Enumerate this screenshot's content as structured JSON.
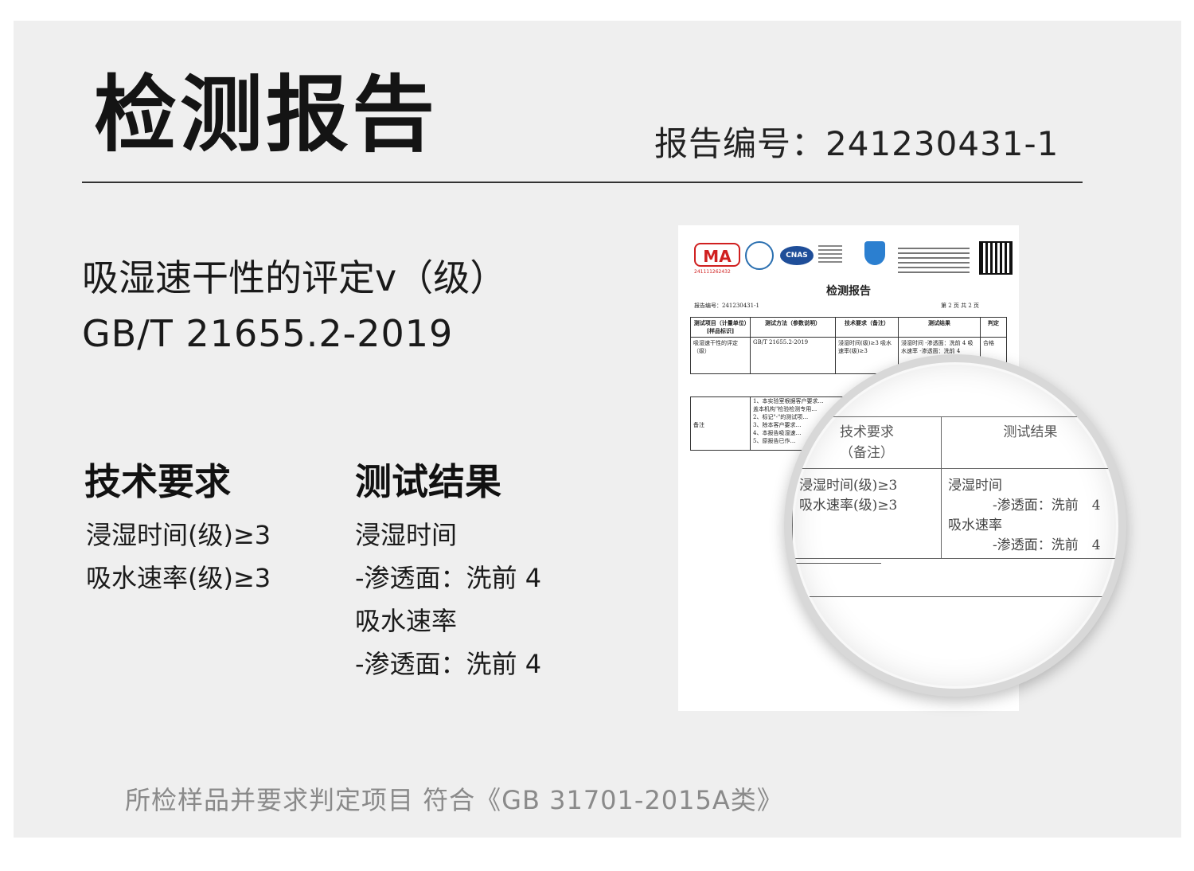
{
  "header": {
    "title": "检测报告",
    "report_no_label": "报告编号：",
    "report_no": "241230431-1"
  },
  "test_item": {
    "name": "吸湿速干性的评定v（级）",
    "standard": "GB/T 21655.2-2019"
  },
  "columns": {
    "requirement_heading": "技术要求",
    "result_heading": "测试结果",
    "requirements": [
      "浸湿时间(级)≥3",
      "吸水速率(级)≥3"
    ],
    "results": [
      "浸湿时间",
      "-渗透面：洗前 4",
      "吸水速率",
      "-渗透面：洗前 4"
    ]
  },
  "footer": {
    "text": "所检样品并要求判定项目 符合《GB 31701-2015A类》"
  },
  "document_image": {
    "cma_label": "MA",
    "cma_number": "241111262432",
    "cnas_label": "CNAS",
    "title": "检测报告",
    "report_no": "报告编号：241230431-1",
    "page": "第 2 页 共 2 页",
    "table_headers": [
      "测试项目（计量单位）[样品标识]",
      "测试方法（参数说明）",
      "技术要求（备注）",
      "测试结果",
      "判定"
    ],
    "row": {
      "item": "吸湿速干性的评定（级）",
      "method": "GB/T 21655.2-2019",
      "requirement": "浸湿时间(级)≥3 吸水速率(级)≥3",
      "result": "浸湿时间 -渗透面：洗前 4 吸水速率 -渗透面：洗前 4",
      "verdict": "合格"
    },
    "remarks_label": "备注",
    "remarks": [
      "1、本实验室根据客户要求…",
      "盖本机构\"检验检测专用…",
      "2、标记\"-\"的测试项…",
      "3、除本客户要求…",
      "4、本报告吸湿速…",
      "5、原报告已作…"
    ]
  },
  "magnifier": {
    "header_req": "技术要求",
    "header_req_note": "（备注）",
    "header_res": "测试结果",
    "requirements": [
      "浸湿时间(级)≥3",
      "吸水速率(级)≥3"
    ],
    "results": [
      "浸湿时间",
      "-渗透面：洗前　4",
      "吸水速率",
      "-渗透面：洗前　4"
    ]
  }
}
